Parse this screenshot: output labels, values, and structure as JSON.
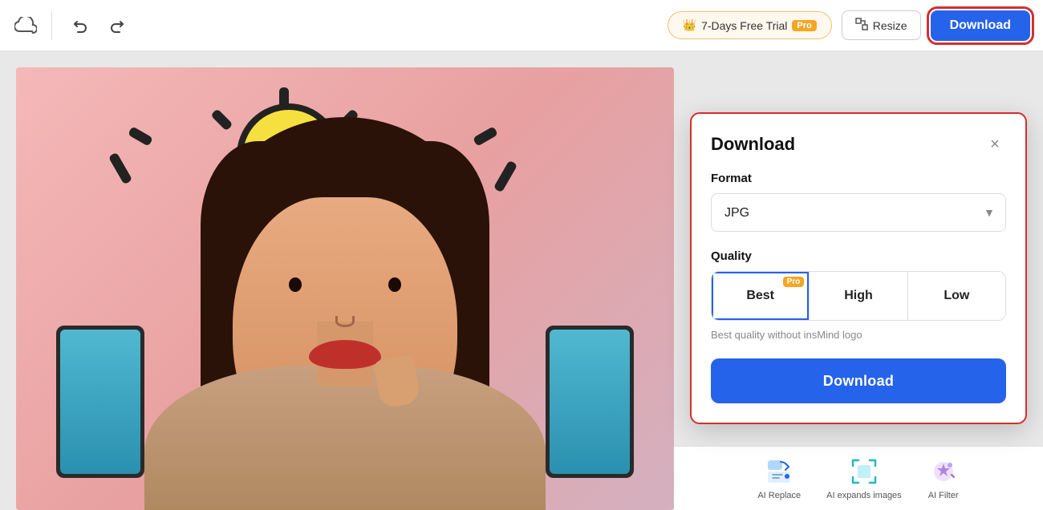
{
  "toolbar": {
    "undo_label": "↩",
    "redo_label": "↪",
    "trial_text": "7-Days Free Trial",
    "trial_pro": "Pro",
    "resize_label": "Resize",
    "download_label": "Download"
  },
  "download_panel": {
    "title": "Download",
    "close_label": "×",
    "format_label": "Format",
    "format_value": "JPG",
    "quality_label": "Quality",
    "quality_options": [
      "Best",
      "High",
      "Low"
    ],
    "quality_pro_badge": "Pro",
    "quality_active": "Best",
    "quality_hint": "Best quality without insMind logo",
    "download_button": "Download"
  },
  "bottom_tools": [
    {
      "id": "ai-replace",
      "icon": "🖌",
      "label": "AI Replace"
    },
    {
      "id": "ai-expands",
      "icon": "⤢",
      "label": "AI expands images"
    },
    {
      "id": "ai-filter",
      "icon": "✦",
      "label": "AI Filter"
    }
  ]
}
